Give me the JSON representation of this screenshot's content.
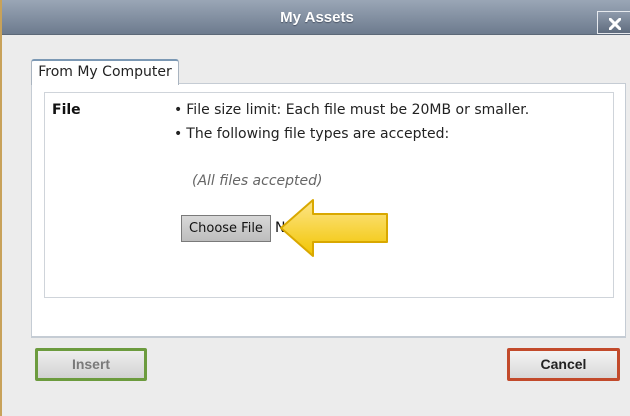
{
  "dialog": {
    "title": "My Assets",
    "close_label": "X"
  },
  "tabs": [
    {
      "label": "From My Computer",
      "active": true
    }
  ],
  "file_section": {
    "label": "File",
    "bullets": [
      "File size limit: Each file must be 20MB or smaller.",
      "The following file types are accepted:"
    ],
    "accepted_note": "(All files accepted)",
    "choose_button": "Choose File",
    "status_text": "No"
  },
  "footer": {
    "insert_label": "Insert",
    "cancel_label": "Cancel"
  },
  "colors": {
    "titlebar": "#7f8c9e",
    "highlight_arrow": "#f7d21f",
    "insert_border": "#6c9b3e",
    "cancel_border": "#c24a2b"
  }
}
